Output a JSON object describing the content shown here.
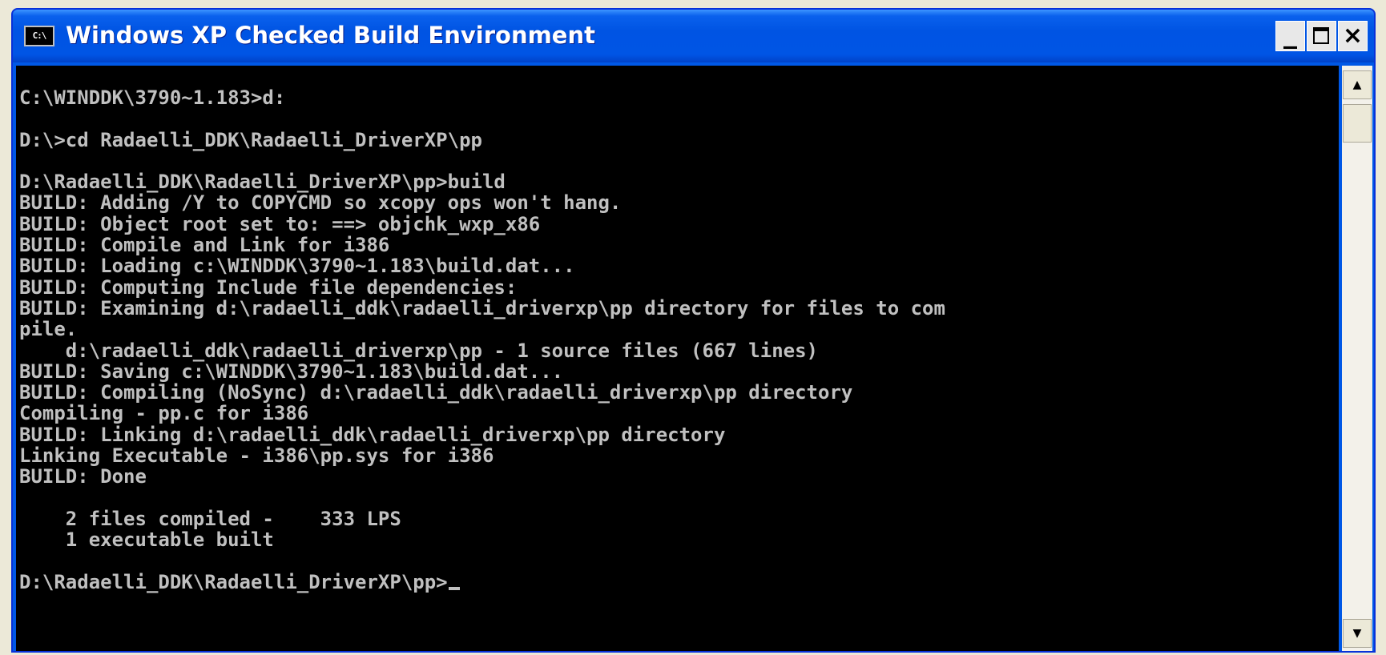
{
  "window": {
    "title": "Windows XP Checked Build Environment",
    "icon_text": "C:\\",
    "icon": "console-icon",
    "controls": {
      "minimize_label": "_",
      "close_label": "×",
      "minimize_icon": "minimize-icon",
      "maximize_icon": "maximize-icon",
      "close_icon": "close-icon"
    }
  },
  "console": {
    "text_color": "#c0c0c0",
    "background": "#000000",
    "lines": [
      "C:\\WINDDK\\3790~1.183>d:",
      "",
      "D:\\>cd Radaelli_DDK\\Radaelli_DriverXP\\pp",
      "",
      "D:\\Radaelli_DDK\\Radaelli_DriverXP\\pp>build",
      "BUILD: Adding /Y to COPYCMD so xcopy ops won't hang.",
      "BUILD: Object root set to: ==> objchk_wxp_x86",
      "BUILD: Compile and Link for i386",
      "BUILD: Loading c:\\WINDDK\\3790~1.183\\build.dat...",
      "BUILD: Computing Include file dependencies:",
      "BUILD: Examining d:\\radaelli_ddk\\radaelli_driverxp\\pp directory for files to com",
      "pile.",
      "    d:\\radaelli_ddk\\radaelli_driverxp\\pp - 1 source files (667 lines)",
      "BUILD: Saving c:\\WINDDK\\3790~1.183\\build.dat...",
      "BUILD: Compiling (NoSync) d:\\radaelli_ddk\\radaelli_driverxp\\pp directory",
      "Compiling - pp.c for i386",
      "BUILD: Linking d:\\radaelli_ddk\\radaelli_driverxp\\pp directory",
      "Linking Executable - i386\\pp.sys for i386",
      "BUILD: Done",
      "",
      "    2 files compiled -    333 LPS",
      "    1 executable built",
      "",
      "D:\\Radaelli_DDK\\Radaelli_DriverXP\\pp>"
    ]
  },
  "scrollbar": {
    "up_arrow": "▲",
    "down_arrow": "▼",
    "up_icon": "scroll-up-icon",
    "down_icon": "scroll-down-icon"
  }
}
